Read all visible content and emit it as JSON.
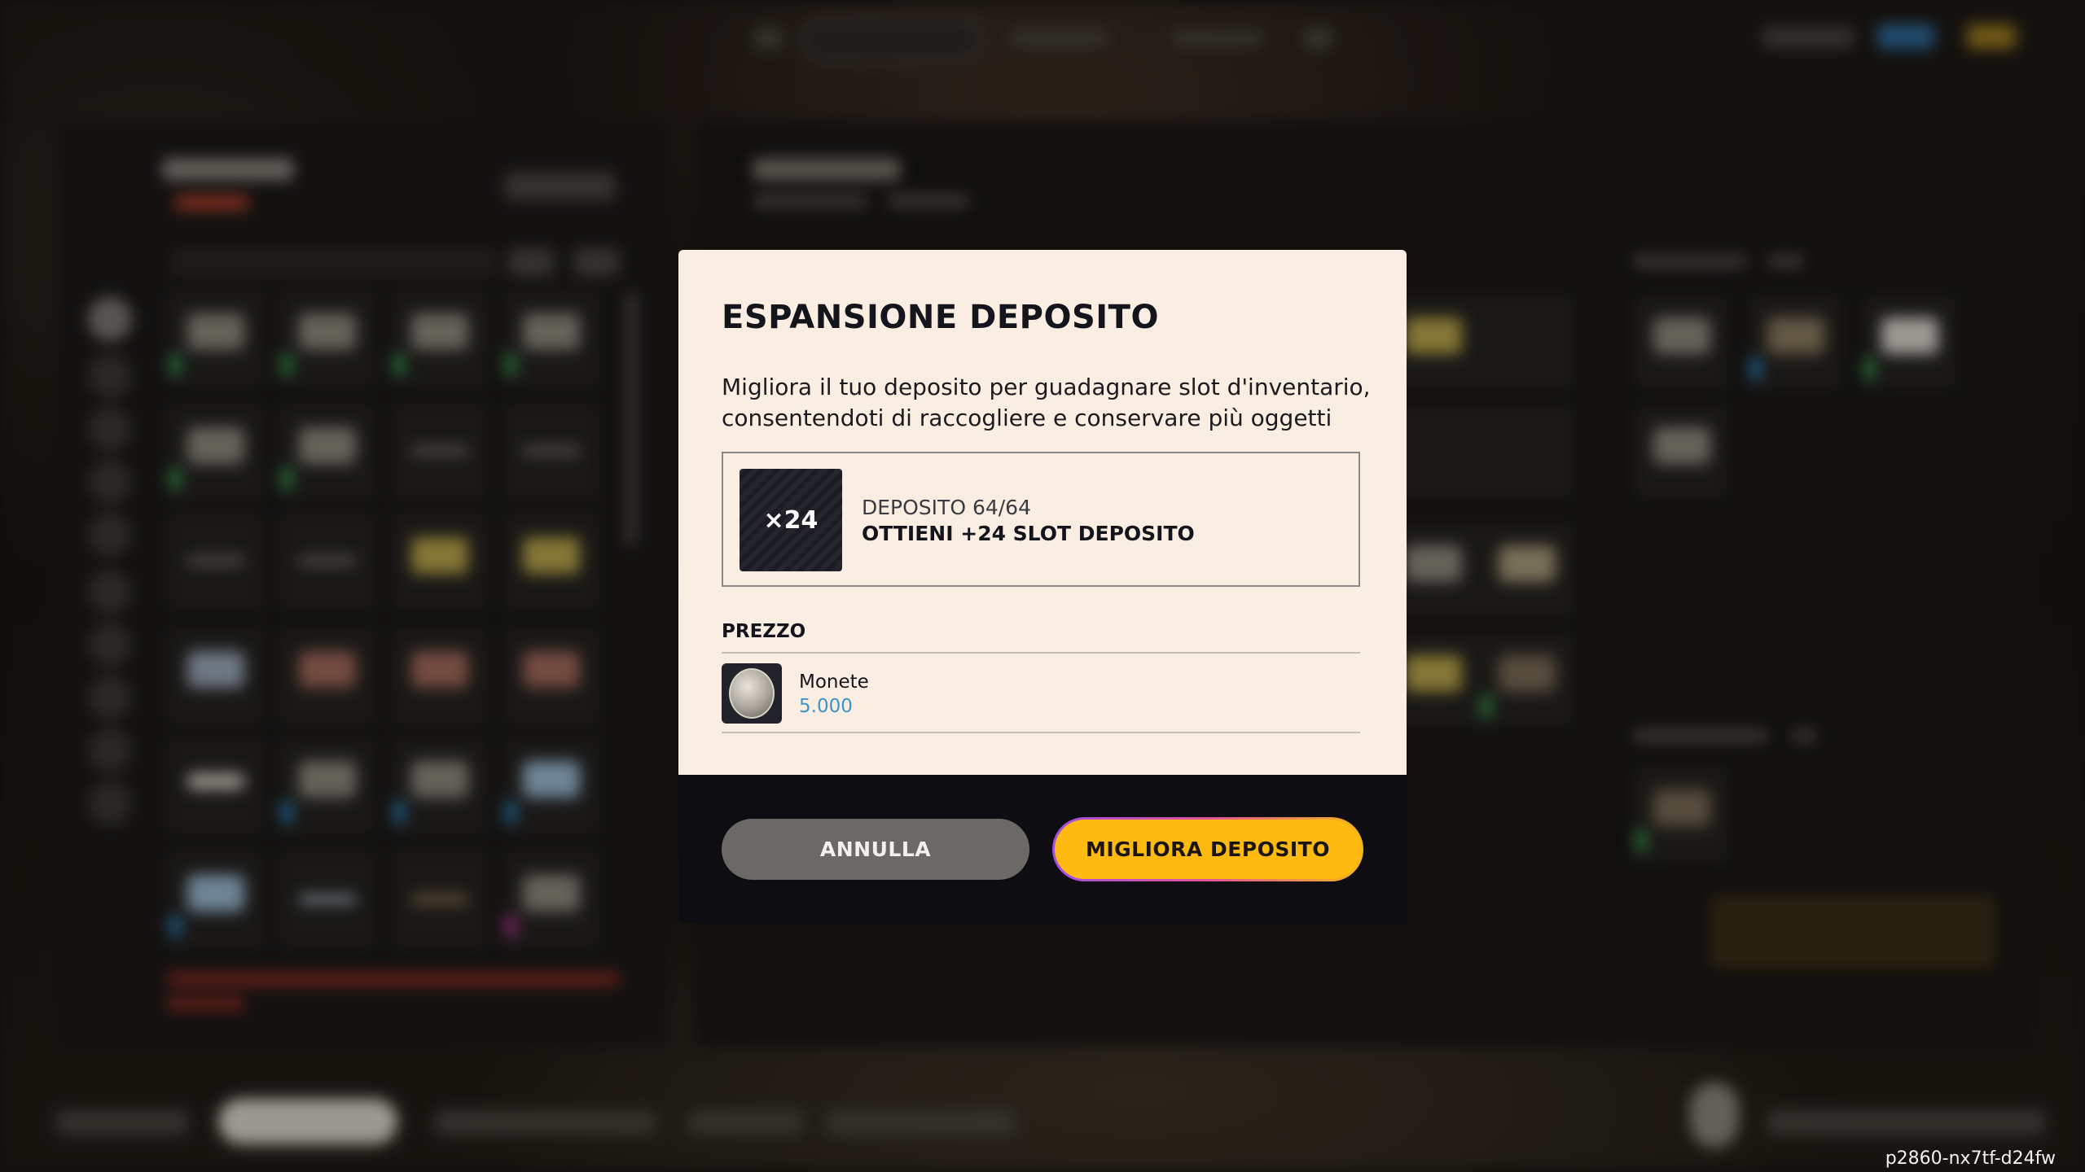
{
  "modal": {
    "title": "ESPANSIONE DEPOSITO",
    "description": "Migliora il tuo deposito per guadagnare slot d'inventario, consentendoti di raccogliere e conservare più oggetti",
    "upgrade_badge": "×24",
    "deposit_status": "DEPOSITO 64/64",
    "deposit_offer": "OTTIENI +24 SLOT DEPOSITO",
    "price_label": "PREZZO",
    "currency_icon": "coin-icon",
    "currency_name": "Monete",
    "currency_amount": "5.000",
    "cancel_label": "ANNULLA",
    "confirm_label": "MIGLIORA DEPOSITO"
  },
  "footer": {
    "build_id": "p2860-nx7tf-d24fw"
  },
  "colors": {
    "modal_background": "#faeee2",
    "modal_footer": "#0d0d12",
    "cancel_button": "#6b6866",
    "confirm_button": "#ffba12",
    "currency_amount": "#3f93c9"
  }
}
